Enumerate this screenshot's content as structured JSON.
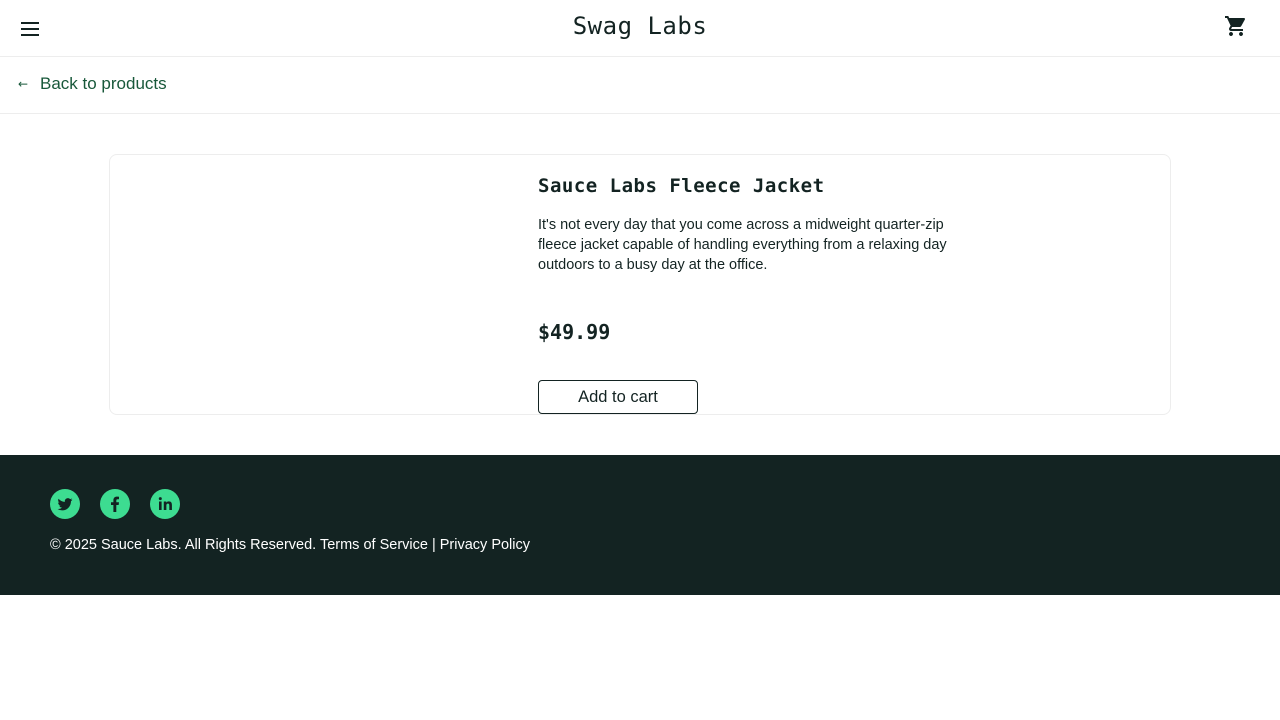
{
  "header": {
    "title": "Swag Labs",
    "menu_icon": "hamburger-menu-icon",
    "cart_icon": "shopping-cart-icon"
  },
  "subheader": {
    "back_label": "Back to products",
    "back_icon": "arrow-left-icon"
  },
  "product": {
    "name": "Sauce Labs Fleece Jacket",
    "description": "It's not every day that you come across a midweight quarter-zip fleece jacket capable of handling everything from a relaxing day outdoors to a busy day at the office.",
    "price": "$49.99",
    "add_button_label": "Add to cart"
  },
  "footer": {
    "social": [
      "twitter-icon",
      "facebook-icon",
      "linkedin-icon"
    ],
    "copyright": "© 2025 Sauce Labs. All Rights Reserved. Terms of Service | Privacy Policy"
  },
  "colors": {
    "accent": "#3ddc91",
    "footer_bg": "#132322",
    "link": "#18583a"
  }
}
